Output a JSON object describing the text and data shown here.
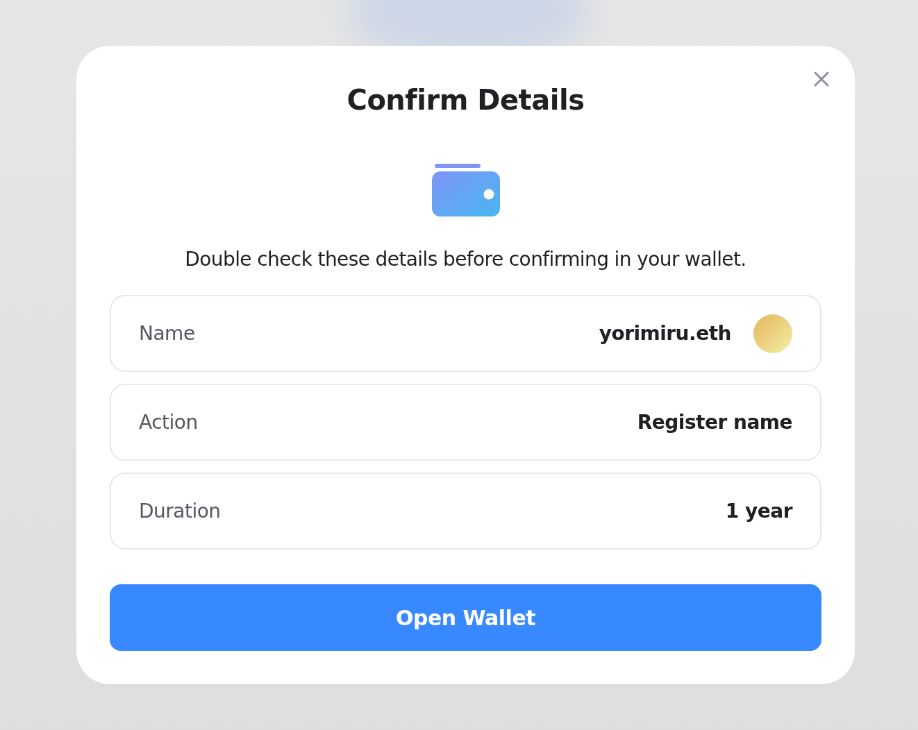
{
  "dialog": {
    "title": "Confirm Details",
    "description": "Double check these details before confirming in your wallet.",
    "rows": [
      {
        "label": "Name",
        "value": "yorimiru.eth",
        "kind": "avatar"
      },
      {
        "label": "Action",
        "value": "Register name",
        "kind": "text"
      },
      {
        "label": "Duration",
        "value": "1 year",
        "kind": "text"
      }
    ],
    "button": "Open Wallet"
  }
}
